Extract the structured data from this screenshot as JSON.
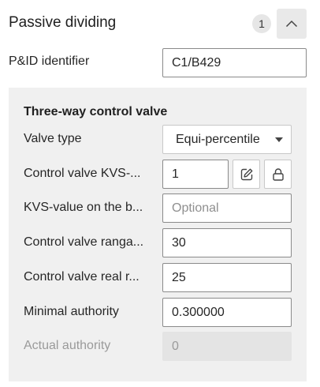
{
  "header": {
    "title": "Passive dividing",
    "count": "1",
    "collapse_icon": "chevron-up-icon"
  },
  "pid": {
    "label": "P&ID identifier",
    "value": "C1/B429"
  },
  "section": {
    "title": "Three-way control valve",
    "fields": {
      "valve_type": {
        "label": "Valve type",
        "value": "Equi-percentile"
      },
      "kvs": {
        "label": "Control valve KVS-...",
        "value": "1",
        "edit_icon": "edit-icon",
        "lock_icon": "lock-icon"
      },
      "kvs_bypass": {
        "label": "KVS-value on the b...",
        "placeholder": "Optional"
      },
      "rangeability": {
        "label": "Control valve ranga...",
        "value": "30"
      },
      "real_range": {
        "label": "Control valve real r...",
        "value": "25"
      },
      "min_authority": {
        "label": "Minimal authority",
        "value": "0.300000"
      },
      "actual_authority": {
        "label": "Actual authority",
        "value": "0"
      }
    }
  }
}
